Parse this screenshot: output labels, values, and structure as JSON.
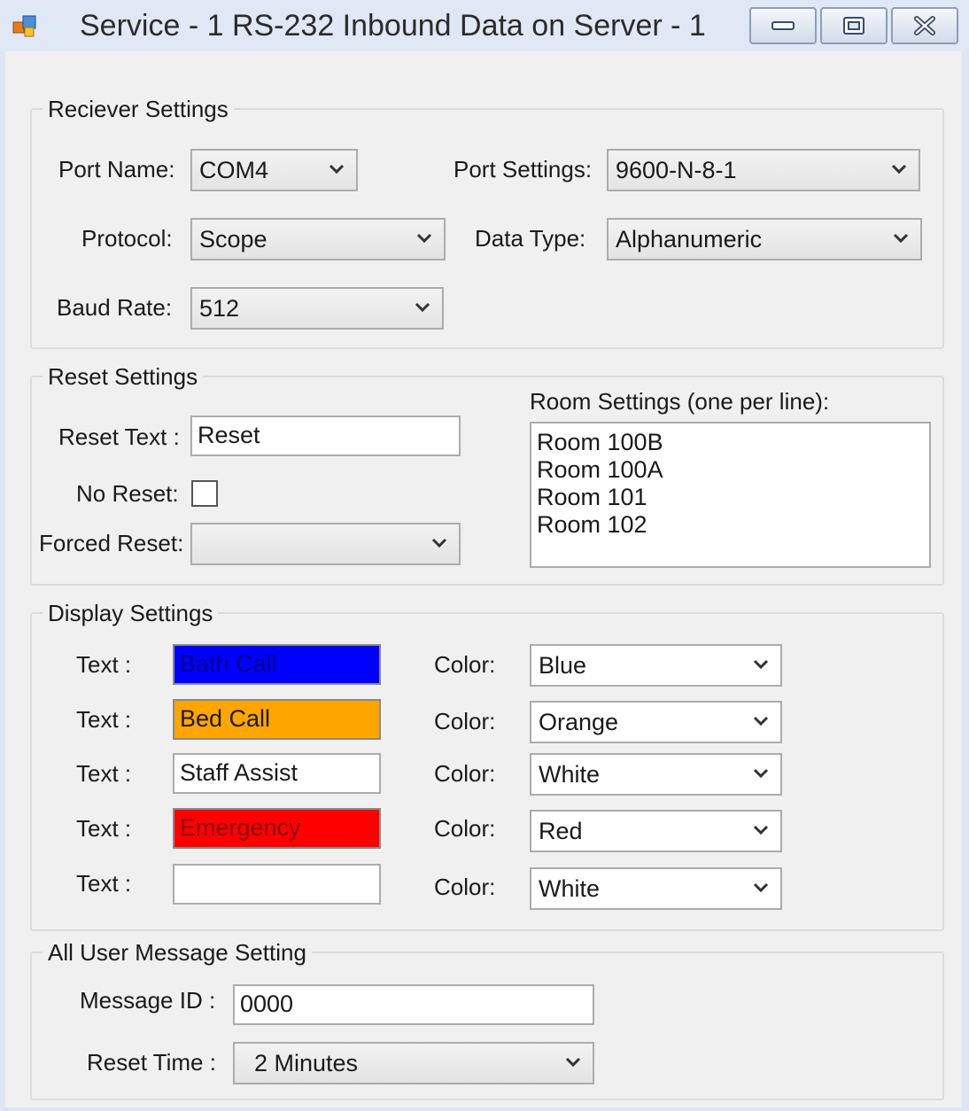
{
  "window": {
    "title": "Service - 1 RS-232 Inbound Data on Server - 1",
    "minimize_icon": "minimize-icon",
    "maximize_icon": "maximize-icon",
    "close_icon": "close-icon"
  },
  "receiver": {
    "legend": "Reciever Settings",
    "port_name_label": "Port Name:",
    "port_name_value": "COM4",
    "port_settings_label": "Port Settings:",
    "port_settings_value": "9600-N-8-1",
    "protocol_label": "Protocol:",
    "protocol_value": "Scope",
    "data_type_label": "Data Type:",
    "data_type_value": "Alphanumeric",
    "baud_rate_label": "Baud Rate:",
    "baud_rate_value": "512"
  },
  "reset": {
    "legend": "Reset Settings",
    "reset_text_label": "Reset Text :",
    "reset_text_value": "Reset",
    "no_reset_label": "No Reset:",
    "forced_reset_label": "Forced Reset:",
    "forced_reset_value": "",
    "room_label": "Room Settings (one per line):",
    "rooms": [
      "Room 100B",
      "Room 100A",
      "Room 101",
      "Room 102"
    ]
  },
  "display": {
    "legend": "Display Settings",
    "text_label": "Text :",
    "color_label": "Color:",
    "rows": [
      {
        "text": "Bath Call",
        "color": "Blue",
        "bg": "#0000ff",
        "fg": "#00008b"
      },
      {
        "text": "Bed Call",
        "color": "Orange",
        "bg": "#ffa500",
        "fg": "#1a1a1a"
      },
      {
        "text": "Staff Assist",
        "color": "White",
        "bg": "#ffffff",
        "fg": "#1a1a1a"
      },
      {
        "text": "Emergency",
        "color": "Red",
        "bg": "#ff0000",
        "fg": "#8b0000"
      },
      {
        "text": "",
        "color": "White",
        "bg": "#ffffff",
        "fg": "#1a1a1a"
      }
    ]
  },
  "message": {
    "legend": "All User Message Setting",
    "message_id_label": "Message ID :",
    "message_id_value": "0000",
    "reset_time_label": "Reset Time :",
    "reset_time_value": "2 Minutes"
  }
}
